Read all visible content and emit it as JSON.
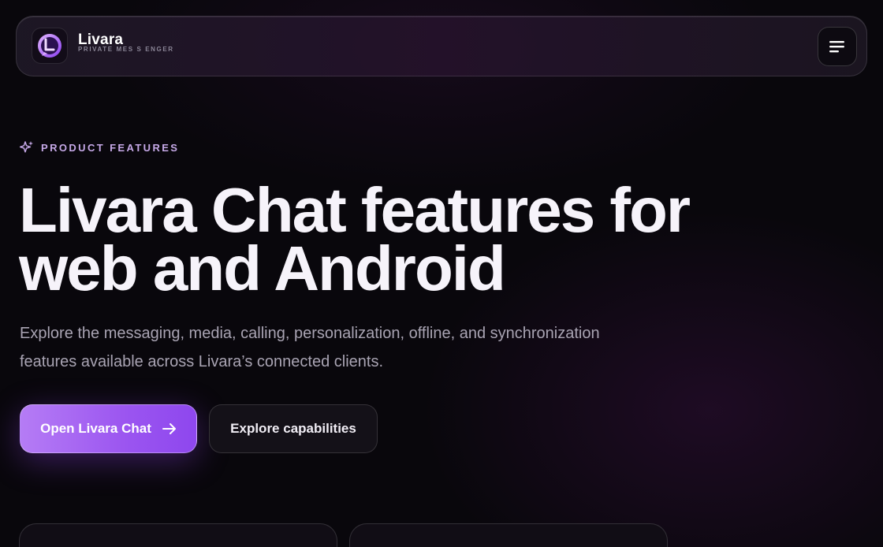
{
  "brand": {
    "name": "Livara",
    "tagline": "PRIVATE MES S ENGER"
  },
  "hero": {
    "eyebrow": "PRODUCT FEATURES",
    "title": "Livara Chat features for web and Android",
    "subtitle": "Explore the messaging, media, calling, personalization, offline, and synchronization features available across Livara’s connected clients.",
    "primary_cta": "Open Livara Chat",
    "secondary_cta": "Explore capabilities"
  },
  "colors": {
    "accent": "#9b55f0",
    "eyebrow": "#c6a9e8",
    "background": "#09070c"
  },
  "icons": {
    "logo": "chat-bubble-logo-icon",
    "menu": "hamburger-menu-icon",
    "eyebrow": "sparkles-icon",
    "cta": "arrow-right-icon"
  }
}
